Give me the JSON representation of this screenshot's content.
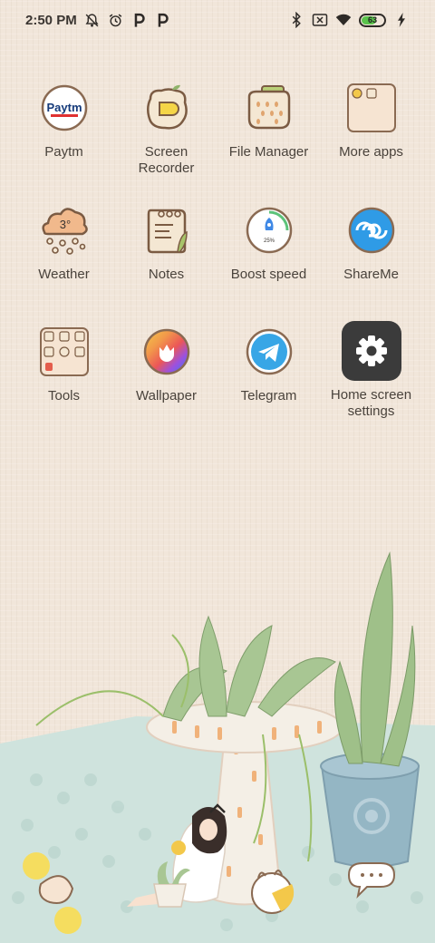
{
  "status_bar": {
    "time": "2:50 PM",
    "battery_level": "63"
  },
  "apps": [
    {
      "label": "Paytm",
      "icon": "paytm-icon",
      "logo_text": "Paytm"
    },
    {
      "label": "Screen\nRecorder",
      "icon": "screen-recorder-icon"
    },
    {
      "label": "File Manager",
      "icon": "file-manager-icon"
    },
    {
      "label": "More apps",
      "icon": "more-apps-folder-icon"
    },
    {
      "label": "Weather",
      "icon": "weather-icon",
      "temp_text": "3°"
    },
    {
      "label": "Notes",
      "icon": "notes-icon"
    },
    {
      "label": "Boost speed",
      "icon": "boost-speed-icon",
      "percent_text": "25%"
    },
    {
      "label": "ShareMe",
      "icon": "shareme-icon"
    },
    {
      "label": "Tools",
      "icon": "tools-folder-icon"
    },
    {
      "label": "Wallpaper",
      "icon": "wallpaper-icon"
    },
    {
      "label": "Telegram",
      "icon": "telegram-icon"
    },
    {
      "label": "Home screen\nsettings",
      "icon": "settings-gear-icon"
    }
  ],
  "colors": {
    "background": "#f1e6da",
    "shareme": "#2f9be6",
    "telegram": "#38a6e6",
    "settings_bg": "#3b3b3b",
    "battery": "#5ac34c"
  }
}
